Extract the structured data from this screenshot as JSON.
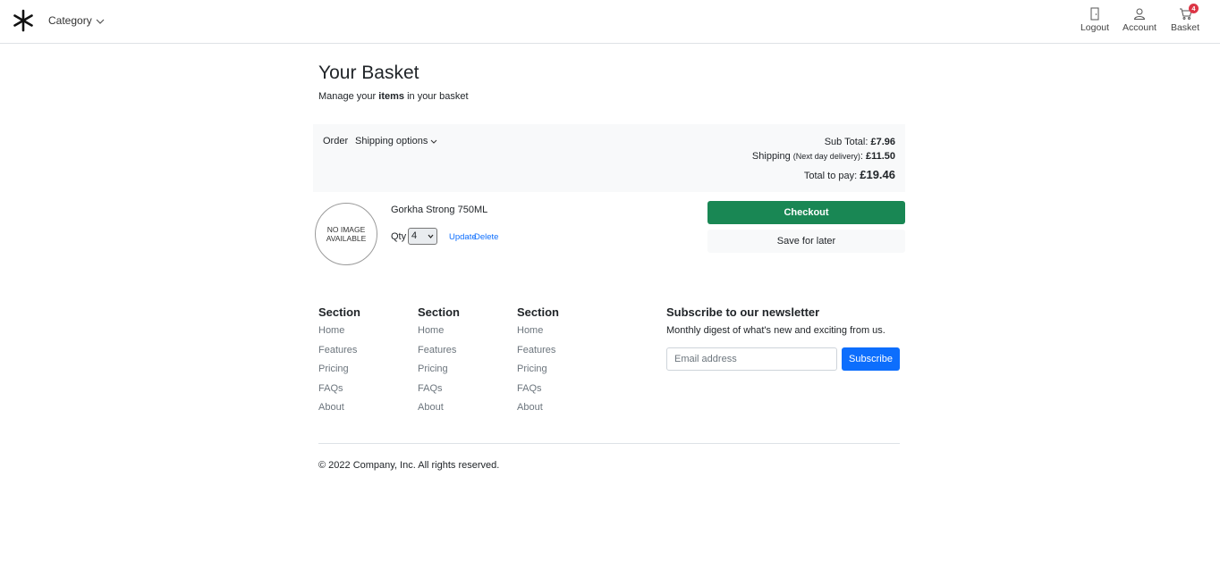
{
  "header": {
    "category_label": "Category",
    "nav": {
      "logout": "Logout",
      "account": "Account",
      "basket": "Basket",
      "basket_count": "4"
    }
  },
  "page": {
    "title": "Your Basket",
    "subtitle_prefix": "Manage your ",
    "subtitle_bold": "items",
    "subtitle_suffix": " in your basket"
  },
  "summary": {
    "order_label": "Order",
    "shipping_options_label": "Shipping options",
    "subtotal_label": "Sub Total: ",
    "subtotal_value": "£7.96",
    "shipping_label": "Shipping ",
    "shipping_note": "(Next day delivery)",
    "shipping_colon": ": ",
    "shipping_value": "£11.50",
    "total_label": "Total to pay: ",
    "total_value": "£19.46"
  },
  "item": {
    "image_placeholder_line1": "NO IMAGE",
    "image_placeholder_line2": "AVAILABLE",
    "name": "Gorkha Strong 750ML",
    "qty_label": "Qty",
    "qty_value": "4",
    "update_label": "Update",
    "delete_label": "Delete"
  },
  "actions": {
    "checkout_label": "Checkout",
    "save_label": "Save for later"
  },
  "footer": {
    "columns": [
      {
        "title": "Section",
        "links": [
          "Home",
          "Features",
          "Pricing",
          "FAQs",
          "About"
        ]
      },
      {
        "title": "Section",
        "links": [
          "Home",
          "Features",
          "Pricing",
          "FAQs",
          "About"
        ]
      },
      {
        "title": "Section",
        "links": [
          "Home",
          "Features",
          "Pricing",
          "FAQs",
          "About"
        ]
      }
    ],
    "newsletter": {
      "title": "Subscribe to our newsletter",
      "description": "Monthly digest of what's new and exciting from us.",
      "email_placeholder": "Email address",
      "subscribe_label": "Subscribe"
    },
    "copyright": "© 2022 Company, Inc. All rights reserved."
  },
  "colors": {
    "checkout": "#198754",
    "subscribe": "#0d6efd",
    "badge": "#dc3545",
    "link": "#0d6efd"
  },
  "icons": {
    "logo": "asterisk-logo-icon",
    "logout": "door-icon",
    "account": "person-icon",
    "basket": "cart-icon"
  }
}
